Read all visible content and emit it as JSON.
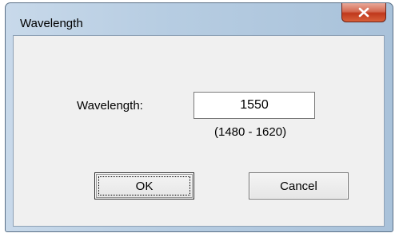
{
  "window": {
    "title": "Wavelength"
  },
  "titlebar": {
    "close_icon": "close-icon"
  },
  "form": {
    "wavelength_label": "Wavelength:",
    "wavelength_value": "1550",
    "range_text": "(1480 - 1620)"
  },
  "buttons": {
    "ok_label": "OK",
    "cancel_label": "Cancel"
  },
  "colors": {
    "close_button": "#c8422a",
    "frame": "#b7cde2",
    "client_bg": "#f0f0f0"
  }
}
